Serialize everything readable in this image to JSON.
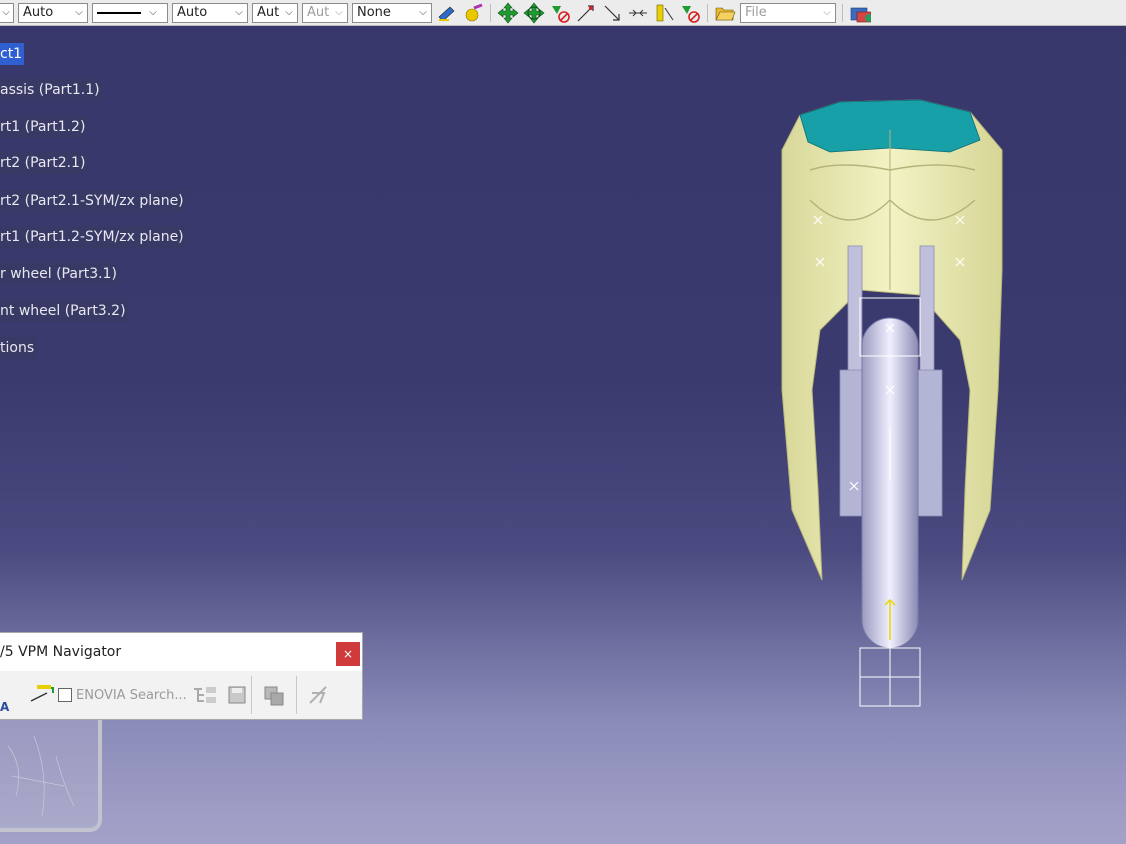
{
  "toolbar": {
    "combo1": "Auto",
    "combo3": "Auto",
    "combo4": "Aut",
    "combo5": "Aut",
    "combo6": "None",
    "file_combo": "File"
  },
  "tree": {
    "items": [
      {
        "label": "ct1",
        "selected": true
      },
      {
        "label": "assis (Part1.1)"
      },
      {
        "label": "rt1 (Part1.2)"
      },
      {
        "label": "rt2 (Part2.1)"
      },
      {
        "label": "rt2 (Part2.1-SYM/zx plane)"
      },
      {
        "label": "rt1 (Part1.2-SYM/zx plane)"
      },
      {
        "label": "r wheel (Part3.1)"
      },
      {
        "label": "nt wheel (Part3.2)"
      },
      {
        "label": "tions"
      }
    ]
  },
  "navigator": {
    "title": "/5 VPM Navigator",
    "close": "×",
    "search_label": "ENOVIA Search..."
  },
  "colors": {
    "background_top": "#37376b",
    "background_bottom": "#a3a3c9",
    "fender": "#e8e8b0",
    "fender_top": "#18a0a8",
    "wheel": "#c8c8e0",
    "selection": "#2f5fd0",
    "close_button": "#cf3b3b"
  }
}
